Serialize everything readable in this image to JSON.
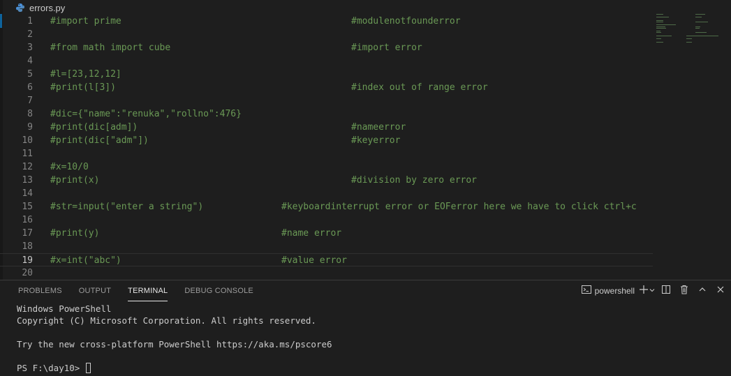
{
  "breadcrumb": {
    "file_name": "errors.py",
    "icon": "python-file-icon"
  },
  "editor": {
    "current_line": 19,
    "lines": [
      {
        "n": "1",
        "code": "#import prime",
        "comment": "#modulenotfounderror"
      },
      {
        "n": "2",
        "code": "",
        "comment": ""
      },
      {
        "n": "3",
        "code": "#from math import cube",
        "comment": "#import error"
      },
      {
        "n": "4",
        "code": "",
        "comment": ""
      },
      {
        "n": "5",
        "code": "#l=[23,12,12]",
        "comment": ""
      },
      {
        "n": "6",
        "code": "#print(l[3])",
        "comment": "#index out of range error"
      },
      {
        "n": "7",
        "code": "",
        "comment": ""
      },
      {
        "n": "8",
        "code": "#dic={\"name\":\"renuka\",\"rollno\":476}",
        "comment": ""
      },
      {
        "n": "9",
        "code": "#print(dic[adm])",
        "comment": "#nameerror"
      },
      {
        "n": "10",
        "code": "#print(dic[\"adm\"])",
        "comment": "#keyerror"
      },
      {
        "n": "11",
        "code": "",
        "comment": ""
      },
      {
        "n": "12",
        "code": "#x=10/0",
        "comment": ""
      },
      {
        "n": "13",
        "code": "#print(x)",
        "comment": "#division by zero error"
      },
      {
        "n": "14",
        "code": "",
        "comment": ""
      },
      {
        "n": "15",
        "code": "#str=input(\"enter a string\")",
        "comment": "#keyboardinterrupt error or EOFerror here we have to click ctrl+c"
      },
      {
        "n": "16",
        "code": "",
        "comment": ""
      },
      {
        "n": "17",
        "code": "#print(y)",
        "comment": "#name error"
      },
      {
        "n": "18",
        "code": "",
        "comment": ""
      },
      {
        "n": "19",
        "code": "#x=int(\"abc\")",
        "comment": "#value error"
      },
      {
        "n": "20",
        "code": "",
        "comment": ""
      }
    ]
  },
  "panel": {
    "tabs": [
      {
        "label": "PROBLEMS",
        "active": false
      },
      {
        "label": "OUTPUT",
        "active": false
      },
      {
        "label": "TERMINAL",
        "active": true
      },
      {
        "label": "DEBUG CONSOLE",
        "active": false
      }
    ],
    "shell_name": "powershell",
    "actions": [
      "terminal-icon",
      "plus-icon",
      "chevron-down-icon",
      "split-icon",
      "trash-icon",
      "chevron-up-icon",
      "close-icon"
    ]
  },
  "terminal": {
    "lines": [
      "Windows PowerShell",
      "Copyright (C) Microsoft Corporation. All rights reserved.",
      "",
      "Try the new cross-platform PowerShell https://aka.ms/pscore6",
      ""
    ],
    "prompt": "PS F:\\day10> "
  },
  "colors": {
    "background": "#1e1e1e",
    "comment": "#6a9955",
    "line_number": "#858585",
    "active_accent": "#0e639c"
  }
}
